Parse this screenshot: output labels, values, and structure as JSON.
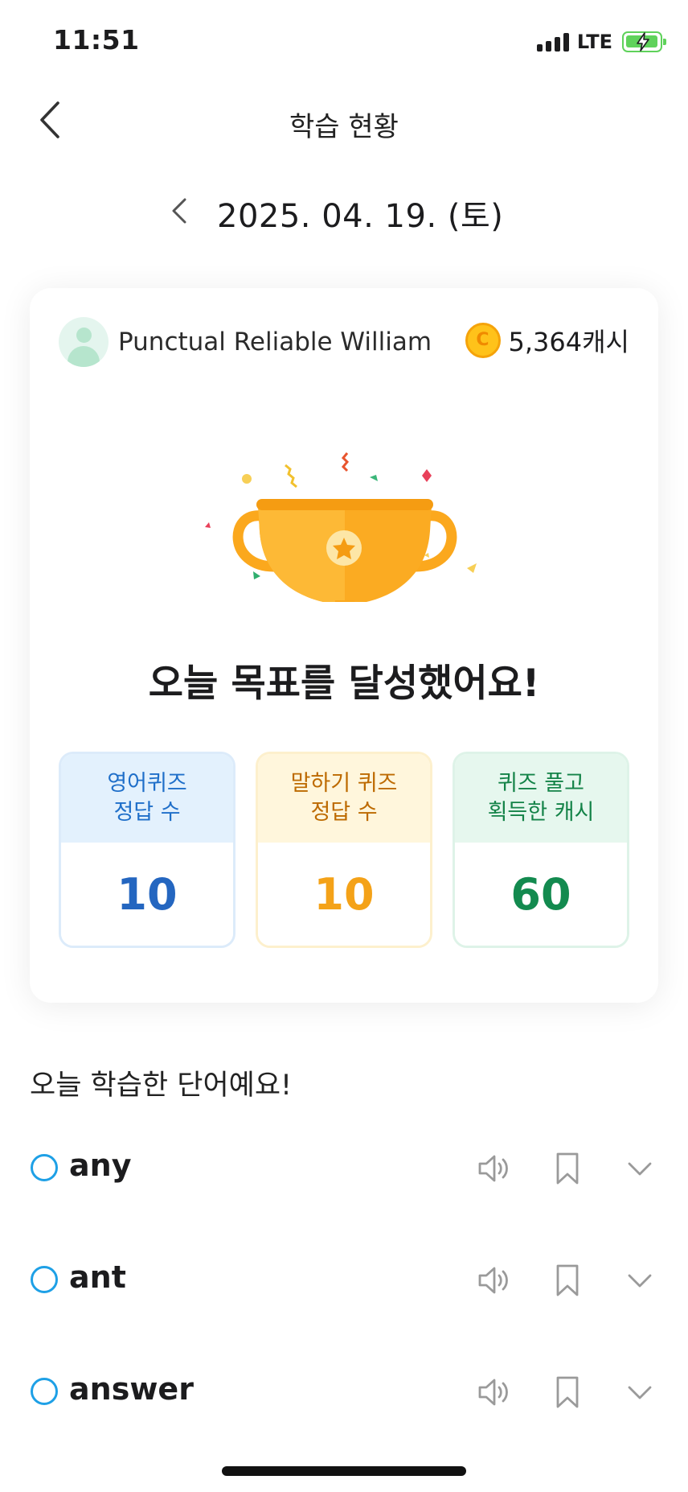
{
  "status_bar": {
    "time": "11:51",
    "network": "LTE",
    "icons": [
      "signal-icon",
      "battery-charging-icon"
    ]
  },
  "header": {
    "title": "학습 현황",
    "back_icon": "chevron-left-icon"
  },
  "date_nav": {
    "date": "2025. 04. 19. (토)",
    "prev_icon": "chevron-left-icon"
  },
  "summary_card": {
    "username": "Punctual Reliable William",
    "cash": "5,364캐시",
    "coin_symbol": "C",
    "trophy_icon": "trophy-icon",
    "achievement_text": "오늘 목표를 달성했어요!",
    "stats": [
      {
        "label": "영어퀴즈\n정답 수",
        "value": "10",
        "accent": "#2466c0"
      },
      {
        "label": "말하기 퀴즈\n정답 수",
        "value": "10",
        "accent": "#f4a218"
      },
      {
        "label": "퀴즈 풀고\n획득한 캐시",
        "value": "60",
        "accent": "#138a4f"
      }
    ]
  },
  "words": {
    "title": "오늘 학습한 단어예요!",
    "items": [
      {
        "word": "any"
      },
      {
        "word": "ant"
      },
      {
        "word": "answer"
      }
    ],
    "row_icons": [
      "speaker-icon",
      "bookmark-icon",
      "chevron-down-icon"
    ]
  },
  "colors": {
    "check_blue": "#1ea0e6",
    "coin": "#ffc21a",
    "trophy": "#fba81d"
  }
}
